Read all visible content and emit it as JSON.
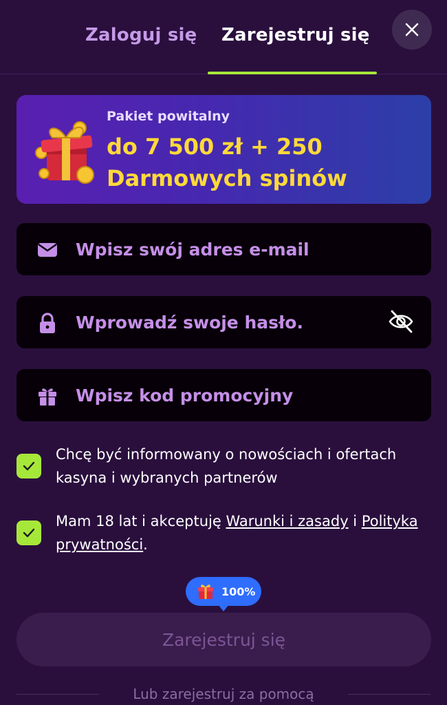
{
  "tabs": {
    "login": "Zaloguj się",
    "register": "Zarejestruj się"
  },
  "promo": {
    "label": "Pakiet powitalny",
    "amount": "do 7 500 zł + 250",
    "spins": "Darmowych spinów"
  },
  "fields": {
    "email_placeholder": "Wpisz swój adres e-mail",
    "password_placeholder": "Wprowadź swoje hasło.",
    "promo_placeholder": "Wpisz kod promocyjny"
  },
  "consents": {
    "newsletter": "Chcę być informowany o nowościach i ofertach kasyna i wybranych partnerów",
    "terms_prefix": "Mam 18 lat i akceptuję ",
    "terms_link": "Warunki i zasady",
    "terms_middle": " i ",
    "privacy_link": "Polityka prywatności",
    "terms_suffix": "."
  },
  "bonus_bubble": "100%",
  "submit_label": "Zarejestruj się",
  "alt_signup": "Lub zarejestruj za pomocą",
  "colors": {
    "background": "#2a0f3d",
    "accent": "#a6e83a",
    "promo_text": "#ffd93a",
    "placeholder": "#c58fe8",
    "bubble": "#2f6dff"
  },
  "icons": {
    "close": "close-icon",
    "gift": "gift-box-icon",
    "email": "envelope-icon",
    "password": "lock-icon",
    "toggle": "eye-off-icon",
    "promo_code": "gift-icon",
    "check": "checkmark-icon"
  }
}
